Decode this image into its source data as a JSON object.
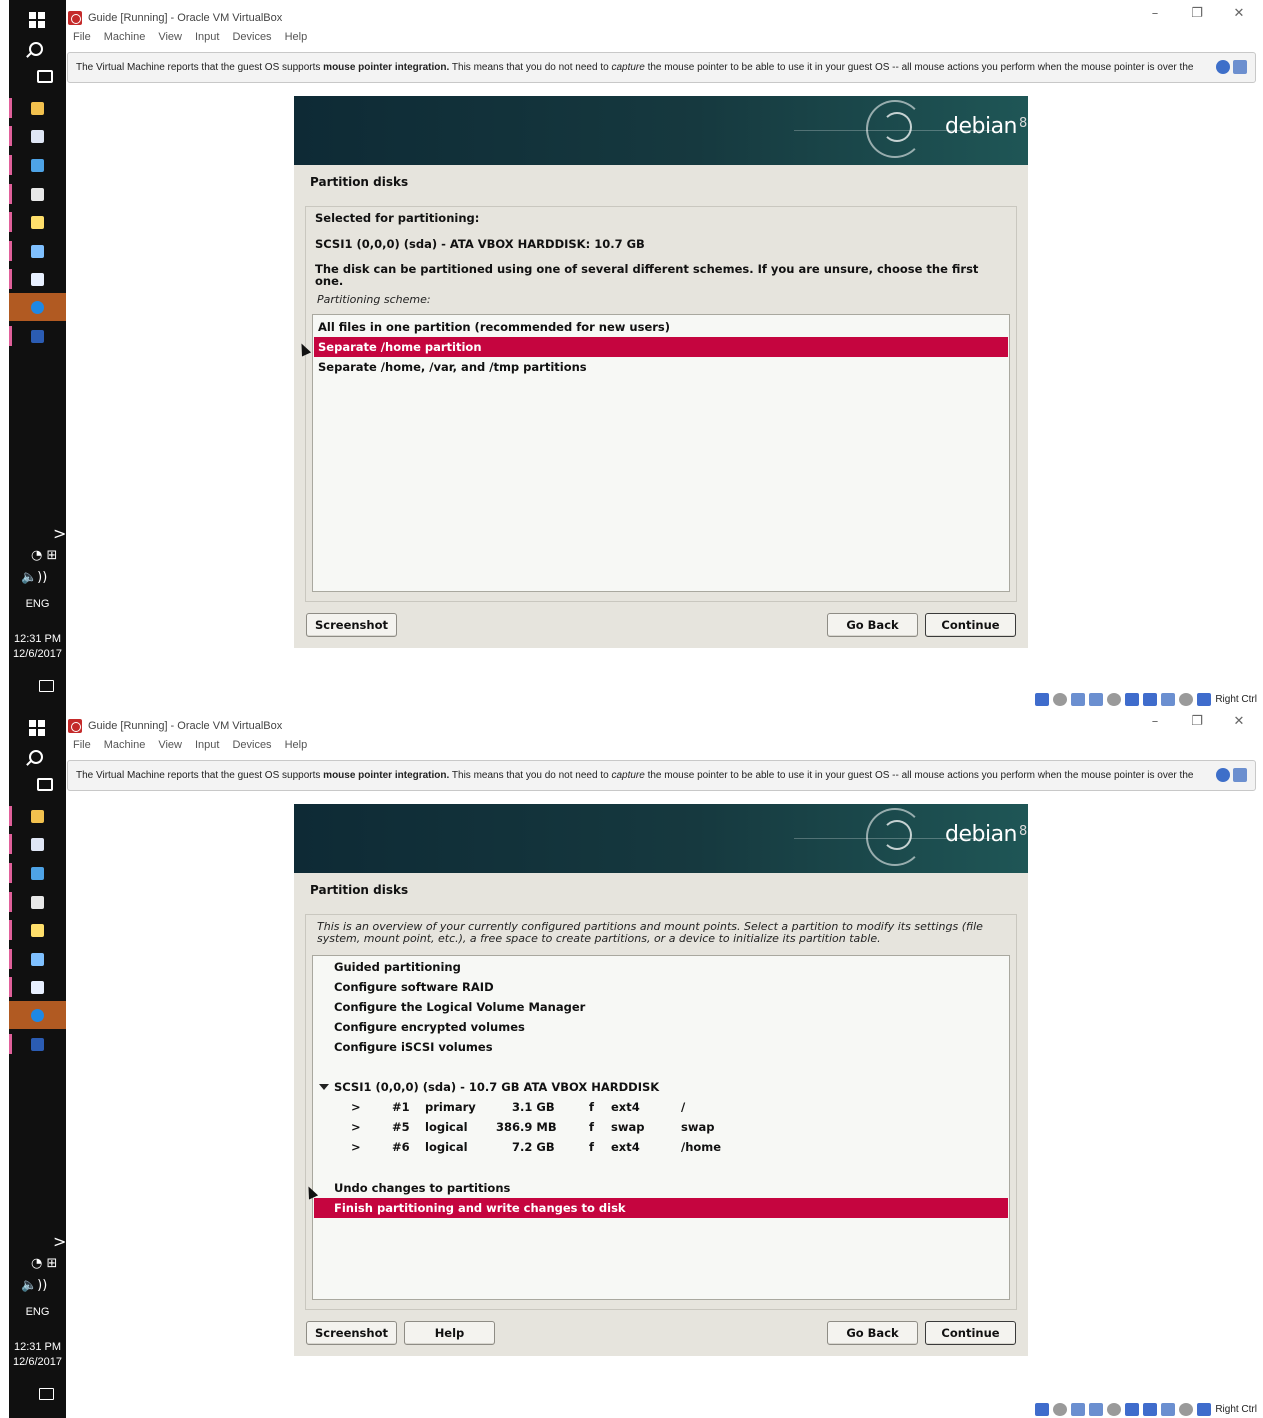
{
  "window": {
    "title": "Guide [Running] - Oracle VM VirtualBox",
    "controls": [
      "–",
      "❐",
      "✕"
    ],
    "menu": [
      "File",
      "Machine",
      "View",
      "Input",
      "Devices",
      "Help"
    ],
    "notice": {
      "before": "The Virtual Machine reports that the guest OS supports ",
      "bold": "mouse pointer integration.",
      "mid": " This means that you do not need to ",
      "italic": "capture",
      "after": " the mouse pointer to be able to use it in your guest OS -- all mouse actions you perform when the mouse pointer is over the"
    },
    "status_host_key": "Right Ctrl"
  },
  "taskbar": {
    "chevron": ">",
    "tray_icons": "◔ ⊞",
    "volume": "🔈))",
    "language": "ENG",
    "time": "12:31 PM",
    "date": "12/6/2017",
    "app_colors": [
      "#f2c14e",
      "#dfe6f5",
      "#4ea3e6",
      "#e8e8e8",
      "#ffdf6b",
      "#7fc0ff",
      "#e8f0ff",
      "#1e88e5",
      "#2b5cb3"
    ]
  },
  "banner": {
    "logo_text": "debian",
    "logo_version": "8"
  },
  "screen1": {
    "title": "Partition disks",
    "selected_label": "Selected for partitioning:",
    "disk": "SCSI1 (0,0,0) (sda) - ATA VBOX HARDDISK: 10.7 GB",
    "instruction": "The disk can be partitioned using one of several different schemes. If you are unsure, choose the first one.",
    "scheme_label": "Partitioning scheme:",
    "options": [
      "All files in one partition (recommended for new users)",
      "Separate /home partition",
      "Separate /home, /var, and /tmp partitions"
    ],
    "selected_index": 1,
    "buttons": {
      "screenshot": "Screenshot",
      "go_back": "Go Back",
      "continue": "Continue"
    }
  },
  "screen2": {
    "title": "Partition disks",
    "overview": "This is an overview of your currently configured partitions and mount points. Select a partition to modify its settings (file system, mount point, etc.), a free space to create partitions, or a device to initialize its partition table.",
    "menu_items": [
      "Guided partitioning",
      "Configure software RAID",
      "Configure the Logical Volume Manager",
      "Configure encrypted volumes",
      "Configure iSCSI volumes"
    ],
    "disk_line": "SCSI1 (0,0,0) (sda) - 10.7 GB ATA VBOX HARDDISK",
    "partitions": [
      {
        "arrow": ">",
        "num": "#1",
        "type": "primary",
        "size": "3.1 GB",
        "flag": "f",
        "fs": "ext4",
        "mount": "/"
      },
      {
        "arrow": ">",
        "num": "#5",
        "type": "logical",
        "size": "386.9 MB",
        "flag": "f",
        "fs": "swap",
        "mount": "swap"
      },
      {
        "arrow": ">",
        "num": "#6",
        "type": "logical",
        "size": "7.2 GB",
        "flag": "f",
        "fs": "ext4",
        "mount": "/home"
      }
    ],
    "undo": "Undo changes to partitions",
    "finish": "Finish partitioning and write changes to disk",
    "buttons": {
      "screenshot": "Screenshot",
      "help": "Help",
      "go_back": "Go Back",
      "continue": "Continue"
    }
  }
}
